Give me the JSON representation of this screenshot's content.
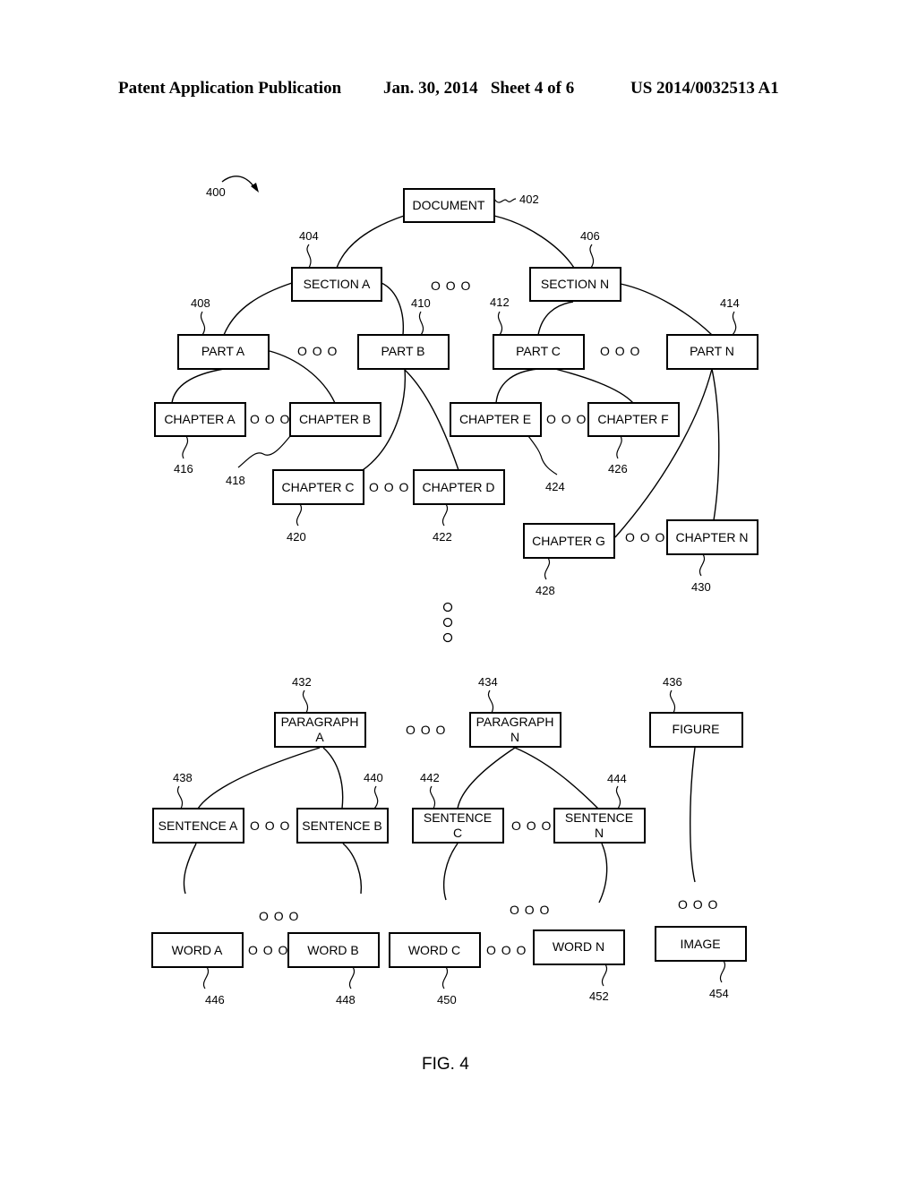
{
  "header": {
    "publication": "Patent Application Publication",
    "date_sheet": "Jan. 30, 2014   Sheet 4 of 6",
    "number": "US 2014/0032513 A1"
  },
  "figure": {
    "ref": "400",
    "caption": "FIG. 4",
    "ellipsis": "O O O",
    "nodes": {
      "document": {
        "label": "DOCUMENT",
        "ref": "402"
      },
      "section_a": {
        "label": "SECTION A",
        "ref": "404"
      },
      "section_n": {
        "label": "SECTION N",
        "ref": "406"
      },
      "part_a": {
        "label": "PART A",
        "ref": "408"
      },
      "part_b": {
        "label": "PART B",
        "ref": "410"
      },
      "part_c": {
        "label": "PART C",
        "ref": "412"
      },
      "part_n": {
        "label": "PART N",
        "ref": "414"
      },
      "chapter_a": {
        "label": "CHAPTER A",
        "ref": "416"
      },
      "chapter_b": {
        "label": "CHAPTER B",
        "ref": "418"
      },
      "chapter_c": {
        "label": "CHAPTER C",
        "ref": "420"
      },
      "chapter_d": {
        "label": "CHAPTER D",
        "ref": "422"
      },
      "chapter_e": {
        "label": "CHAPTER E",
        "ref": "424"
      },
      "chapter_f": {
        "label": "CHAPTER F",
        "ref": "426"
      },
      "chapter_g": {
        "label": "CHAPTER G",
        "ref": "428"
      },
      "chapter_n": {
        "label": "CHAPTER N",
        "ref": "430"
      },
      "paragraph_a": {
        "label1": "PARAGRAPH",
        "label2": "A",
        "ref": "432"
      },
      "paragraph_n": {
        "label1": "PARAGRAPH",
        "label2": "N",
        "ref": "434"
      },
      "figure": {
        "label": "FIGURE",
        "ref": "436"
      },
      "sentence_a": {
        "label": "SENTENCE A",
        "ref": "438"
      },
      "sentence_b": {
        "label": "SENTENCE B",
        "ref": "440"
      },
      "sentence_c": {
        "label1": "SENTENCE",
        "label2": "C",
        "ref": "442"
      },
      "sentence_n": {
        "label1": "SENTENCE",
        "label2": "N",
        "ref": "444"
      },
      "word_a": {
        "label": "WORD A",
        "ref": "446"
      },
      "word_b": {
        "label": "WORD B",
        "ref": "448"
      },
      "word_c": {
        "label": "WORD C",
        "ref": "450"
      },
      "word_n": {
        "label": "WORD N",
        "ref": "452"
      },
      "image": {
        "label": "IMAGE",
        "ref": "454"
      }
    },
    "edges": [
      [
        "document",
        "section_a"
      ],
      [
        "document",
        "section_n"
      ],
      [
        "section_a",
        "part_a"
      ],
      [
        "section_a",
        "part_b"
      ],
      [
        "section_n",
        "part_c"
      ],
      [
        "section_n",
        "part_n"
      ],
      [
        "part_a",
        "chapter_a"
      ],
      [
        "part_a",
        "chapter_b"
      ],
      [
        "part_b",
        "chapter_c"
      ],
      [
        "part_b",
        "chapter_d"
      ],
      [
        "part_c",
        "chapter_e"
      ],
      [
        "part_c",
        "chapter_f"
      ],
      [
        "part_n",
        "chapter_g"
      ],
      [
        "part_n",
        "chapter_n"
      ],
      [
        "paragraph_a",
        "sentence_a"
      ],
      [
        "paragraph_a",
        "sentence_b"
      ],
      [
        "paragraph_n",
        "sentence_c"
      ],
      [
        "paragraph_n",
        "sentence_n"
      ]
    ]
  }
}
